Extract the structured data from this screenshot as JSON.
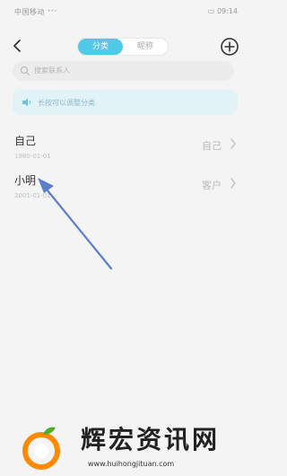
{
  "status_bar": {
    "left_text": "中国移动 ᐩᐩᐟ ",
    "right_text": "▭ 09:14"
  },
  "header": {
    "tabs": [
      {
        "label": "分类"
      },
      {
        "label": "昵称"
      }
    ]
  },
  "search": {
    "placeholder": "搜索联系人"
  },
  "notice": {
    "text": "长按可以调整分类"
  },
  "contacts": [
    {
      "name": "自己",
      "subtitle": "1980-01-01",
      "tag": "自己"
    },
    {
      "name": "小明",
      "subtitle": "2001-01-01",
      "tag": "客户"
    }
  ],
  "watermark": {
    "title": "辉宏资讯网",
    "url": "www.huihongjituan.com"
  },
  "colors": {
    "accent": "#4fc9e5",
    "arrow": "#5b80c9"
  }
}
